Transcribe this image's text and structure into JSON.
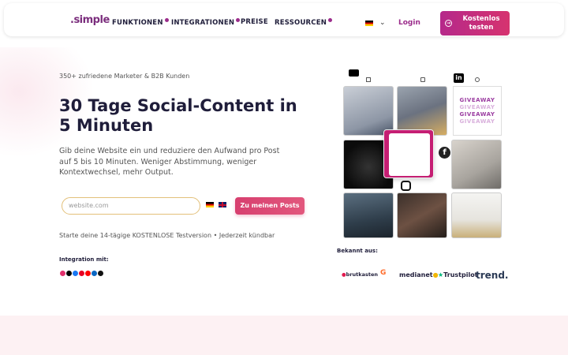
{
  "nav": {
    "logo_text": ".simple",
    "items": [
      "FUNKTIONEN",
      "INTEGRATIONEN",
      "PREISE",
      "RESSOURCEN"
    ],
    "login": "Login",
    "cta": "Kostenlos testen"
  },
  "hero": {
    "social_proof": "350+ zufriedene Marketer & B2B Kunden",
    "title": "30 Tage Social-Content in 5 Minuten",
    "subtitle": "Gib deine Website ein und reduziere den Aufwand pro Post auf 5 bis 10 Minuten. Weniger Abstimmung, weniger Kontextwechsel, mehr Output.",
    "input_placeholder": "website.com",
    "button": "Zu meinen Posts",
    "trial": "Starte deine 14-tägige KOSTENLOSE Testversion • Jederzeit kündbar",
    "integration_label": "Integration mit:"
  },
  "grid": {
    "giveaway_text": "GIVEAWAY"
  },
  "press": {
    "label": "Bekannt aus:",
    "logos": [
      "brutkasten",
      "G",
      "medianet",
      "Trustpilot",
      "trend."
    ]
  },
  "colors": {
    "brand": "#9b2c8b",
    "accent": "#d73f6f"
  }
}
